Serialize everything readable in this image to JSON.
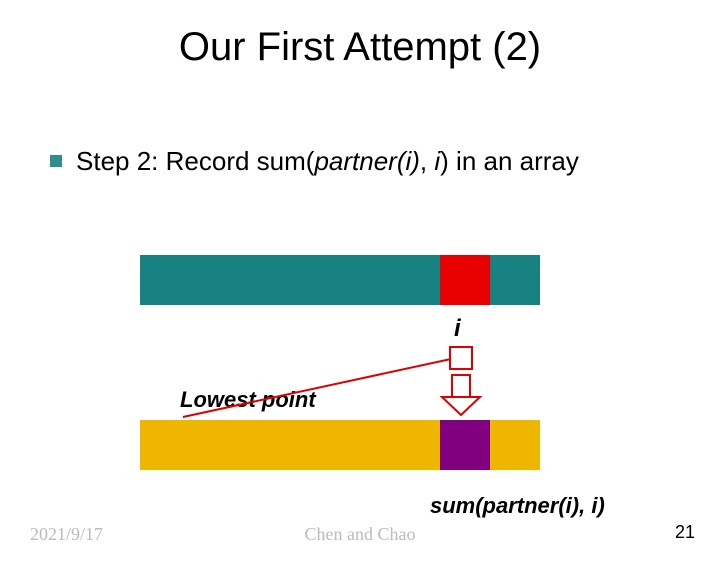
{
  "title": "Our First Attempt (2)",
  "step": {
    "prefix": "Step 2: Record sum(",
    "arg1": "partner(i)",
    "sep": ", ",
    "arg2": "i",
    "suffix": ") in an array"
  },
  "labels": {
    "i": "i",
    "lowest": "Lowest point",
    "sum": "sum(partner(i), i)"
  },
  "arrays": {
    "top": {
      "cells": 8,
      "highlight_index": 6,
      "base_color": "#188181",
      "highlight_color": "#e80000"
    },
    "bottom": {
      "cells": 8,
      "highlight_index": 6,
      "base_color": "#efb600",
      "highlight_color": "#800080"
    }
  },
  "footer": {
    "date": "2021/9/17",
    "author": "Chen and Chao",
    "page": "21"
  }
}
